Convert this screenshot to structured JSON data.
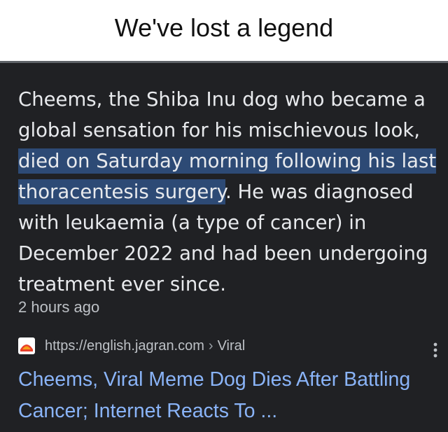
{
  "header": {
    "title": "We've lost a legend"
  },
  "snippet": {
    "intro": "Cheems, the Shiba Inu dog who became a global sensation for his mischievous look, ",
    "highlight": "died on Saturday morning following his last thoracentesis surgery",
    "rest": ". He was diagnosed with leukaemia (a type of cancer) in December 2022 and had been undergoing treatment ever since.",
    "time": "2 hours ago"
  },
  "result": {
    "url": "https://english.jagran.com",
    "separator": "›",
    "section": "Viral",
    "title": "Cheems, Viral Meme Dog Dies After Battling Cancer; Internet Reacts To ...",
    "favicon_icon": "jagran-favicon-icon",
    "more_icon": "more-vert-icon"
  },
  "colors": {
    "background": "#202124",
    "highlight": "#2d4a75",
    "link": "#8ab4f8",
    "text": "#e8eaed",
    "muted": "#bdc1c6"
  }
}
